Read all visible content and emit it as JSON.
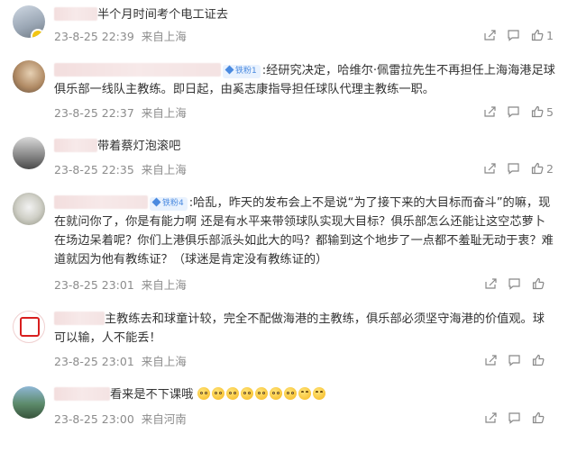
{
  "comments": [
    {
      "text": "半个月时间考个电工证去",
      "date": "23-8-25 22:39",
      "location": "来自上海",
      "likes": "1"
    },
    {
      "badge": "铁粉1",
      "text": ":经研究决定，哈维尔·佩雷拉先生不再担任上海海港足球俱乐部一线队主教练。即日起，由奚志康指导担任球队代理主教练一职。",
      "date": "23-8-25 22:37",
      "location": "来自上海",
      "likes": "5"
    },
    {
      "text": "带着蔡灯泡滚吧",
      "date": "23-8-25 22:35",
      "location": "来自上海",
      "likes": "2"
    },
    {
      "badge": "铁粉4",
      "text": ":哈乱，昨天的发布会上不是说“为了接下来的大目标而奋斗”的嘛，现在就问你了，你是有能力啊 还是有水平来带领球队实现大目标？俱乐部怎么还能让这空芯萝卜在场边呆着呢？你们上港俱乐部派头如此大的吗？都输到这个地步了一点都不羞耻无动于衷？难道就因为他有教练证？（球迷是肯定没有教练证的）",
      "date": "23-8-25 23:01",
      "location": "来自上海",
      "likes": ""
    },
    {
      "text": "主教练去和球童计较，完全不配做海港的主教练，俱乐部必须坚守海港的价值观。球可以输，人不能丢！",
      "date": "23-8-25 23:01",
      "location": "来自上海",
      "likes": ""
    },
    {
      "text": "看来是不下课哦",
      "date": "23-8-25 23:00",
      "location": "来自河南",
      "likes": ""
    }
  ],
  "icons": {
    "share": "share-icon",
    "comment": "comment-icon",
    "like": "thumbs-up-icon"
  },
  "colors": {
    "text": "#333333",
    "meta": "#8c8c8c",
    "badge_bg": "#e9f2fe",
    "badge_fg": "#4a8ae0"
  }
}
